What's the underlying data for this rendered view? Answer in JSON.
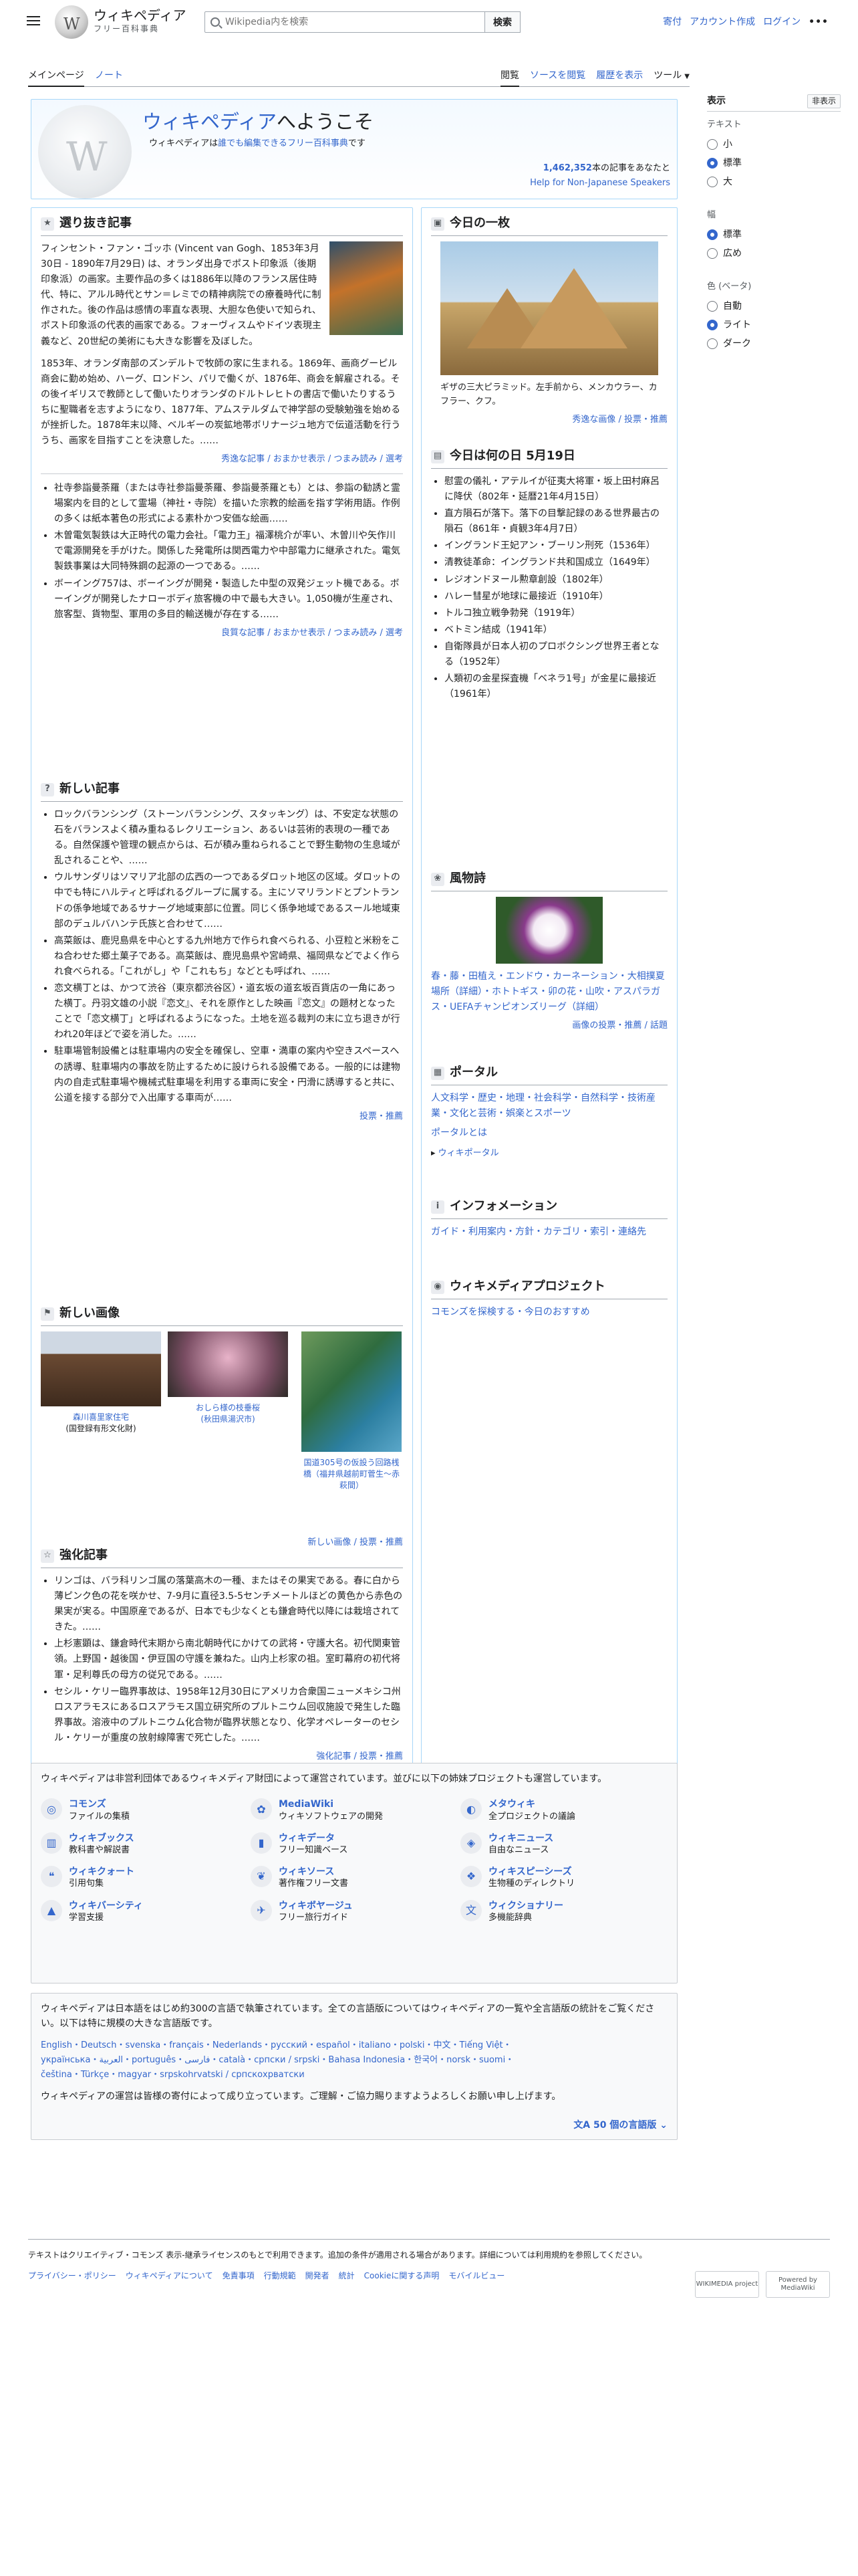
{
  "header": {
    "logo_title": "ウィキペディア",
    "logo_sub": "フリー百科事典",
    "search_placeholder": "Wikipedia内を検索",
    "search_button": "検索",
    "links": [
      "寄付",
      "アカウント作成",
      "ログイン"
    ],
    "more": "•••"
  },
  "tabs": {
    "main": "メインページ",
    "talk": "ノート",
    "read": "閲覧",
    "view_source": "ソースを閲覧",
    "history": "履歴を表示",
    "tools": "ツール"
  },
  "side": {
    "title": "表示",
    "hide": "非表示",
    "text_label": "テキスト",
    "text_options": [
      "小",
      "標準",
      "大"
    ],
    "width_label": "幅",
    "width_options": [
      "標準",
      "広め"
    ],
    "color_label": "色 (ベータ)",
    "color_options": [
      "自動",
      "ライト",
      "ダーク"
    ]
  },
  "welcome": {
    "title_link": "ウィキペディア",
    "title_rest": "へようこそ",
    "sub_a": "ウィキペディアは",
    "sub_link": "誰でも編集できるフリー百科事典",
    "sub_b": "です",
    "count_num": "1,462,352",
    "count_rest": "本の記事をあなたと",
    "help": "Help for Non-Japanese Speakers"
  },
  "featured": {
    "title": "選り抜き記事",
    "p1": "フィンセント・ファン・ゴッホ (Vincent van Gogh、1853年3月30日 - 1890年7月29日) は、オランダ出身でポスト印象派（後期印象派）の画家。主要作品の多くは1886年以降のフランス居住時代、特に、アルル時代とサン＝レミでの精神病院での療養時代に制作された。後の作品は感情の率直な表現、大胆な色使いで知られ、ポスト印象派の代表的画家である。フォーヴィスムやドイツ表現主義など、20世紀の美術にも大きな影響を及ぼした。",
    "p2": "1853年、オランダ南部のズンデルトで牧師の家に生まれる。1869年、画商グーピル商会に勤め始め、ハーグ、ロンドン、パリで働くが、1876年、商会を解雇される。その後イギリスで教師として働いたりオランダのドルトレヒトの書店で働いたりするうちに聖職者を志すようになり、1877年、アムステルダムで神学部の受験勉強を始めるが挫折した。1878年末以降、ベルギーの炭鉱地帯ボリナージュ地方で伝道活動を行ううち、画家を目指すことを決意した。……",
    "more": "秀逸な記事 / おまかせ表示 / つまみ読み / 選考",
    "list": [
      "社寺参詣曼荼羅（または寺社参詣曼荼羅、参詣曼荼羅とも）とは、参詣の勧誘と霊場案内を目的として霊場（神社・寺院）を描いた宗教的絵画を指す学術用語。作例の多くは紙本著色の形式による素朴かつ安価な絵画……",
      "木曽電気製鉄は大正時代の電力会社。「電力王」福澤桃介が率い、木曽川や矢作川で電源開発を手がけた。関係した発電所は関西電力や中部電力に継承された。電気製鉄事業は大同特殊鋼の起源の一つである。……",
      "ボーイング757は、ボーイングが開発・製造した中型の双発ジェット機である。ボーイングが開発したナローボディ旅客機の中で最も大きい。1,050機が生産され、旅客型、貨物型、軍用の多目的輸送機が存在する……"
    ],
    "more2": "良質な記事 / おまかせ表示 / つまみ読み / 選考"
  },
  "news": {
    "title": "新しい記事",
    "items": [
      "ロックバランシング（ストーンバランシング、スタッキング）は、不安定な状態の石をバランスよく積み重ねるレクリエーション、あるいは芸術的表現の一種である。自然保護や管理の観点からは、石が積み重ねられることで野生動物の生息域が乱されることや、……",
      "ウルサンダリはソマリア北部の広西の一つであるダロット地区の区域。ダロットの中でも特にハルティと呼ばれるグループに属する。主にソマリランドとプントランドの係争地域であるサナーグ地域東部に位置。同じく係争地域であるスール地域東部のデュルバハンテ氏族と合わせて……",
      "高菜飯は、鹿児島県を中心とする九州地方で作られ食べられる、小豆粒と米粉をこね合わせた郷土菓子である。高菜飯は、鹿児島県や宮崎県、福岡県などでよく作られ食べられる。「これがし」や「これもち」などとも呼ばれ、……",
      "恋文横丁とは、かつて渋谷（東京都渋谷区）・道玄坂の道玄坂百貨店の一角にあった横丁。丹羽文雄の小説『恋文』、それを原作とした映画『恋文』の題材となったことで「恋文横丁」と呼ばれるようになった。土地を巡る裁判の末に立ち退きが行われ20年ほどで姿を消した。……",
      "駐車場管制設備とは駐車場内の安全を確保し、空車・満車の案内や空きスペースへの誘導、駐車場内の事故を防止するために設けられる設備である。一般的には建物内の自走式駐車場や機械式駐車場を利用する車両に安全・円滑に誘導すると共に、公道を接する部分で入出庫する車両が……"
    ],
    "more": "投票・推薦"
  },
  "images": {
    "title": "新しい画像",
    "cap1a": "森川喜里家住宅",
    "cap1b": "(国登録有形文化財)",
    "cap2a": "おしら様の枝垂桜",
    "cap2b": "(秋田県湯沢市)",
    "cap3": "国道305号の仮設う回路桟橋（福井県越前町菅生〜赤萩間）",
    "more": "新しい画像 / 投票・推薦"
  },
  "improved": {
    "title": "強化記事",
    "items": [
      "リンゴは、バラ科リンゴ属の落葉高木の一種、またはその果実である。春に白から薄ピンク色の花を咲かせ、7-9月に直径3.5-5センチメートルほどの黄色から赤色の果実が実る。中国原産であるが、日本でも少なくとも鎌倉時代以降には栽培されてきた。……",
      "上杉憲顕は、鎌倉時代末期から南北朝時代にかけての武将・守護大名。初代関東管領。上野国・越後国・伊豆国の守護を兼ねた。山内上杉家の祖。室町幕府の初代将軍・足利尊氏の母方の従兄である。……",
      "セシル・ケリー臨界事故は、1958年12月30日にアメリカ合衆国ニューメキシコ州ロスアラモスにあるロスアラモス国立研究所のプルトニウム回収施設で発生した臨界事故。溶液中のプルトニウム化合物が臨界状態となり、化学オペレーターのセシル・ケリーが重度の放射線障害で死亡した。……"
    ],
    "more": "強化記事 / 投票・推薦"
  },
  "picture": {
    "title": "今日の一枚",
    "caption": "ギザの三大ピラミッド。左手前から、メンカウラー、カフラー、クフ。",
    "more": "秀逸な画像 / 投票・推薦"
  },
  "today": {
    "title": "今日は何の日 5月19日",
    "items": [
      "慰霊の儀礼・アテルイが征夷大将軍・坂上田村麻呂に降伏（802年・延暦21年4月15日）",
      "直方隕石が落下。落下の目撃記録のある世界最古の隕石（861年・貞観3年4月7日）",
      "イングランド王妃アン・ブーリン刑死（1536年）",
      "清教徒革命：イングランド共和国成立（1649年）",
      "レジオンドヌール勲章創設（1802年）",
      "ハレー彗星が地球に最接近（1910年）",
      "トルコ独立戦争勃発（1919年）",
      "ベトミン結成（1941年）",
      "自衛隊員が日本人初のプロボクシング世界王者となる（1952年）",
      "人類初の金星探査機「ベネラ1号」が金星に最接近（1961年）"
    ]
  },
  "seasonal": {
    "title": "風物詩",
    "text": "春・藤・田植え・エンドウ・カーネーション・大相撲夏場所（詳細）・ホトトギス・卯の花・山吹・アスパラガス・UEFAチャンピオンズリーグ（詳細）",
    "more": "画像の投票・推薦 / 話題"
  },
  "portal": {
    "title": "ポータル",
    "text": "人文科学・歴史・地理・社会科学・自然科学・技術産業・文化と芸術・娯楽とスポーツ",
    "more": "ポータルとは",
    "toggle": "ウィキポータル"
  },
  "info": {
    "title": "インフォメーション",
    "text": "ガイド・利用案内・方針・カテゴリ・索引・連絡先"
  },
  "project": {
    "title": "ウィキメディアプロジェクト",
    "text": "コモンズを探検する・今日のおすすめ"
  },
  "projects_box": {
    "intro": "ウィキペディアは非営利団体であるウィキメディア財団によって運営されています。並びに以下の姉妹プロジェクトも運営しています。",
    "items": [
      {
        "t": "コモンズ",
        "d": "ファイルの集積"
      },
      {
        "t": "MediaWiki",
        "d": "ウィキソフトウェアの開発"
      },
      {
        "t": "メタウィキ",
        "d": "全プロジェクトの議論"
      },
      {
        "t": "ウィキブックス",
        "d": "教科書や解説書"
      },
      {
        "t": "ウィキデータ",
        "d": "フリー知識ベース"
      },
      {
        "t": "ウィキニュース",
        "d": "自由なニュース"
      },
      {
        "t": "ウィキクォート",
        "d": "引用句集"
      },
      {
        "t": "ウィキソース",
        "d": "著作権フリー文書"
      },
      {
        "t": "ウィキスピーシーズ",
        "d": "生物種のディレクトリ"
      },
      {
        "t": "ウィキバーシティ",
        "d": "学習支援"
      },
      {
        "t": "ウィキボヤージュ",
        "d": "フリー旅行ガイド"
      },
      {
        "t": "ウィクショナリー",
        "d": "多機能辞典"
      }
    ]
  },
  "langs_box": {
    "intro": "ウィキペディアは日本語をはじめ約300の言語で執筆されています。全ての言語版についてはウィキペディアの一覧や全言語版の統計をご覧ください。以下は特に規模の大きな言語版です。",
    "list1": "English・Deutsch・svenska・français・Nederlands・русский・español・italiano・polski・中文・Tiếng Việt・",
    "list2": "українська・العربية・português・فارسی・català・српски / srpski・Bahasa Indonesia・한국어・norsk・suomi・",
    "list3": "čeština・Türkçe・magyar・srpskohrvatski / српскохрватски",
    "foot": "ウィキペディアの運営は皆様の寄付によって成り立っています。ご理解・ご協力賜りますようよろしくお願い申し上げます。",
    "button": "50 個の言語版"
  },
  "page_foot": {
    "license": "テキストはクリエイティブ・コモンズ 表示-継承ライセンスのもとで利用できます。追加の条件が適用される場合があります。詳細については利用規約を参照してください。",
    "links": [
      "プライバシー・ポリシー",
      "ウィキペディアについて",
      "免責事項",
      "行動規範",
      "開発者",
      "統計",
      "Cookieに関する声明",
      "モバイルビュー"
    ],
    "badge1": "WIKIMEDIA project",
    "badge2": "Powered by MediaWiki"
  }
}
